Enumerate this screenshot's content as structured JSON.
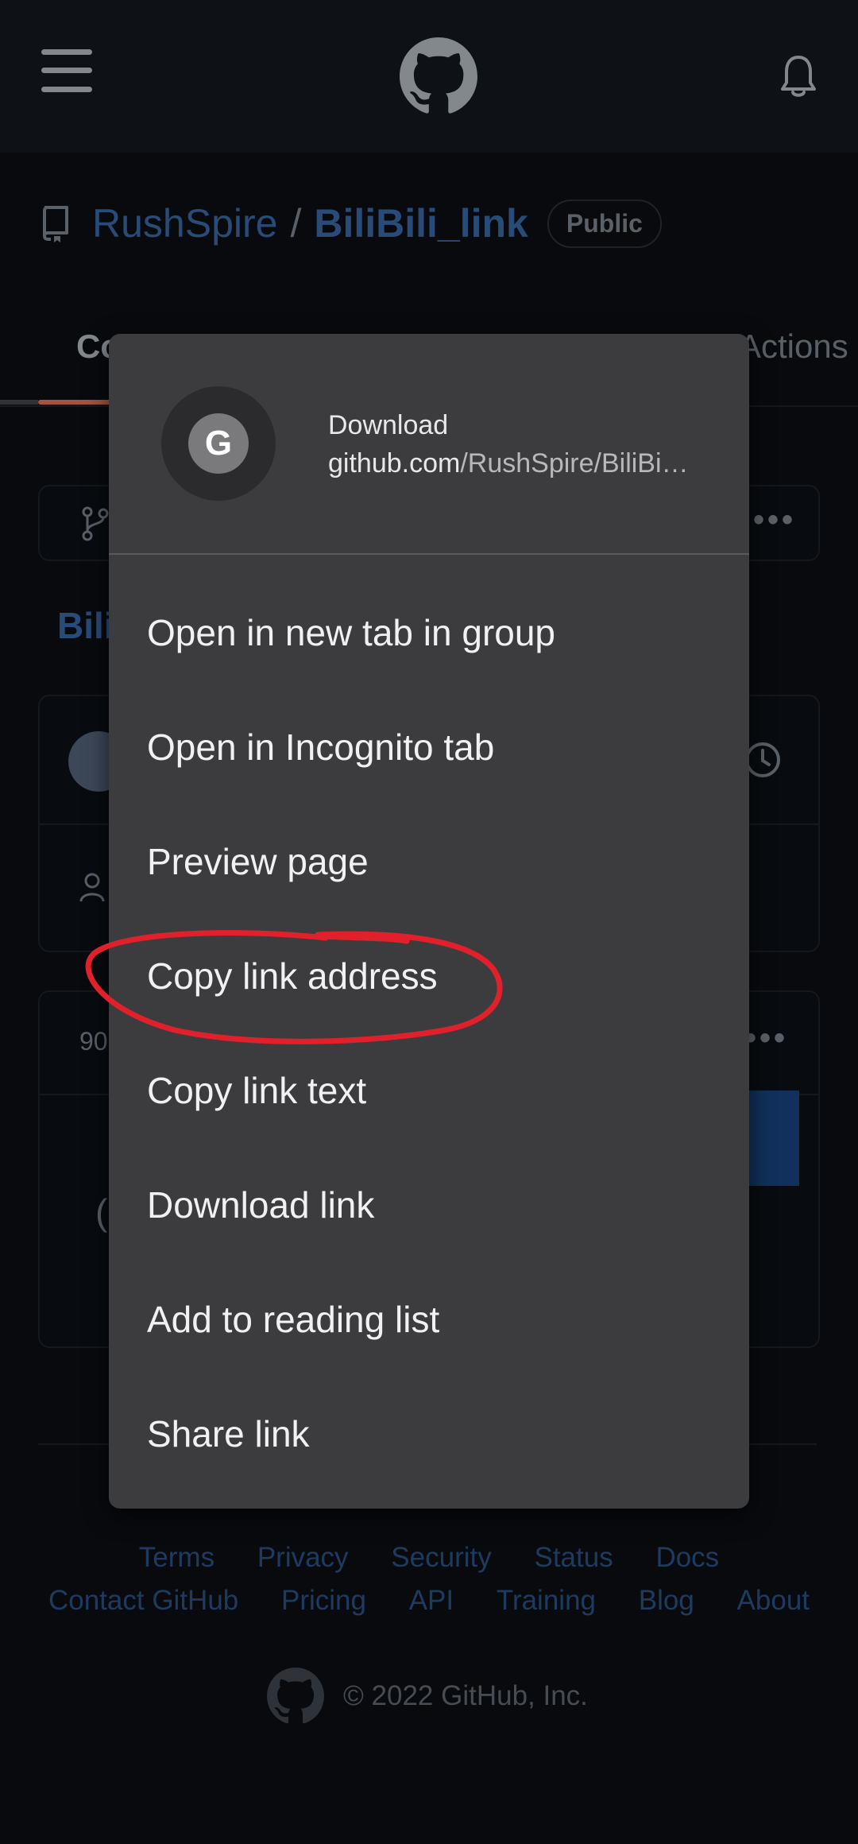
{
  "header": {
    "menu_icon": "hamburger-menu-icon",
    "logo_icon": "github-octocat-icon",
    "bell_icon": "notification-bell-icon"
  },
  "repo": {
    "owner": "RushSpire",
    "separator": "/",
    "name": "BiliBili_link",
    "visibility": "Public"
  },
  "tabs": {
    "code_label": "Co",
    "actions_label": "Actions"
  },
  "background": {
    "repo_title_partial": "Bili",
    "count_partial": "90",
    "paren_partial": "("
  },
  "context_menu": {
    "avatar_letter": "G",
    "title": "Download",
    "url_domain": "github.com",
    "url_path": "/RushSpire/BiliBi…",
    "items": [
      {
        "label": "Open in new tab in group"
      },
      {
        "label": "Open in Incognito tab"
      },
      {
        "label": "Preview page"
      },
      {
        "label": "Copy link address"
      },
      {
        "label": "Copy link text"
      },
      {
        "label": "Download link"
      },
      {
        "label": "Add to reading list"
      },
      {
        "label": "Share link"
      }
    ]
  },
  "footer": {
    "row1": [
      "Terms",
      "Privacy",
      "Security",
      "Status",
      "Docs"
    ],
    "row2": [
      "Contact GitHub",
      "Pricing",
      "API",
      "Training",
      "Blog",
      "About"
    ],
    "copyright": "© 2022 GitHub, Inc."
  },
  "annotation": {
    "highlight_color": "#e0202a"
  }
}
